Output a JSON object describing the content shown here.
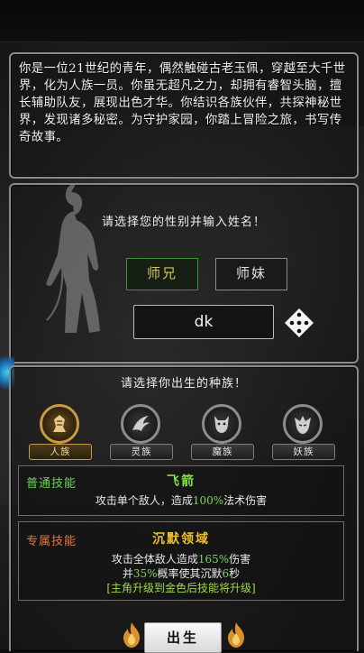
{
  "story": {
    "text": "你是一位21世纪的青年，偶然触碰古老玉佩，穿越至大千世界，化为人族一员。你虽无超凡之力，却拥有睿智头脑，擅长辅助队友，展现出色才华。你结识各族伙伴，共探神秘世界，发现诸多秘密。为守护家园，你踏上冒险之旅，书写传奇故事。"
  },
  "gender": {
    "prompt": "请选择您的性别并输入姓名！",
    "male_label": "师兄",
    "female_label": "师妹",
    "selected": "male",
    "name_value": "dk"
  },
  "race": {
    "prompt": "请选择你出生的种族！",
    "items": [
      {
        "label": "人族",
        "icon": "human-clan-icon",
        "selected": true
      },
      {
        "label": "灵族",
        "icon": "spirit-clan-icon",
        "selected": false
      },
      {
        "label": "魔族",
        "icon": "demon-clan-icon",
        "selected": false
      },
      {
        "label": "妖族",
        "icon": "yao-clan-icon",
        "selected": false
      }
    ]
  },
  "skills": {
    "normal": {
      "label": "普通技能",
      "name": "飞箭",
      "desc_a": "攻击单个敌人，造成",
      "desc_pct": "100%",
      "desc_b": "法术伤害"
    },
    "special": {
      "label": "专属技能",
      "name": "沉默领域",
      "line1_a": "攻击全体敌人造成",
      "line1_pct": "165%",
      "line1_b": "伤害",
      "line2_a": "并",
      "line2_pct": "35%",
      "line2_b": "概率使其沉默",
      "line2_num": "6",
      "line2_c": "秒",
      "line3": "[主角升级到金色后技能将升级]"
    }
  },
  "born_button": "出生",
  "colors": {
    "green_label": "#6fd05a",
    "orange_label": "#e0783a",
    "skill_name_normal": "#7ee04a",
    "skill_name_special": "#f0c030",
    "gold": "#c99a45"
  }
}
